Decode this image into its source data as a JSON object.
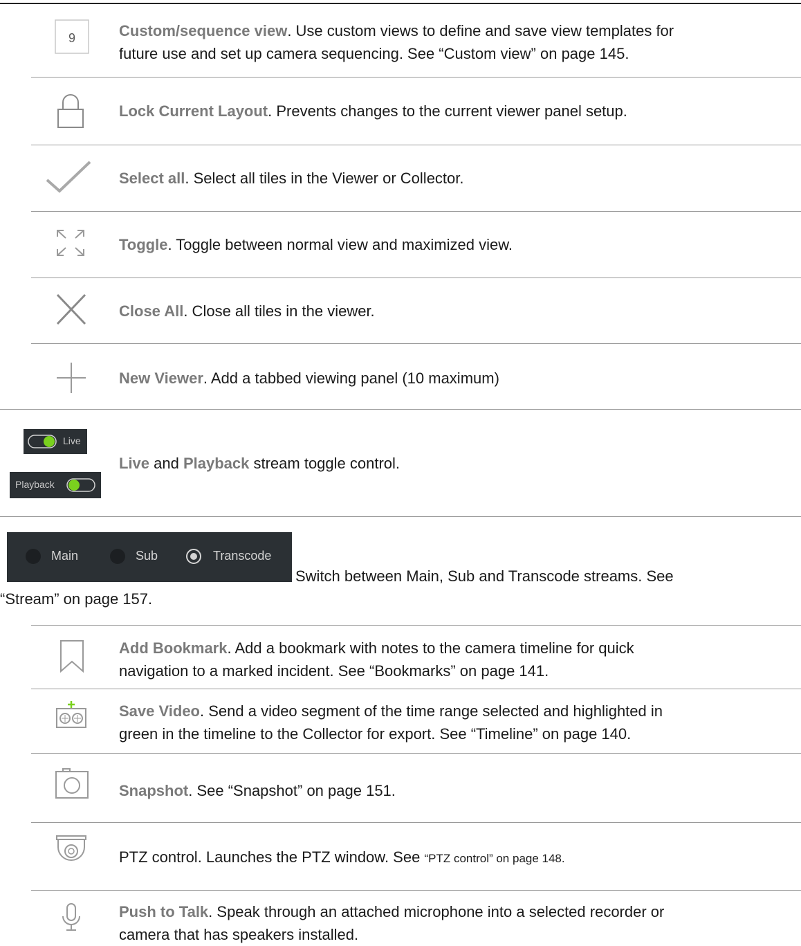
{
  "rows": {
    "custom": {
      "icon_number": "9",
      "term": "Custom/sequence view",
      "line1": ". Use custom views to define and save view templates for",
      "line2": "future use and set up camera sequencing. See “Custom view” on page 145."
    },
    "lock": {
      "term": "Lock Current Layout",
      "desc": ". Prevents changes to the current viewer panel setup."
    },
    "select_all": {
      "term": "Select all",
      "desc": ". Select all tiles in the Viewer or Collector."
    },
    "toggle": {
      "term": "Toggle",
      "desc": ". Toggle between normal view and maximized view."
    },
    "close_all": {
      "term": "Close All",
      "desc": ". Close all tiles in the viewer."
    },
    "new_viewer": {
      "term": "New Viewer",
      "desc": ". Add a tabbed viewing panel (10 maximum)"
    },
    "live_playback": {
      "live_label": "Live",
      "playback_label": "Playback",
      "term1": "Live",
      "and": " and ",
      "term2": "Playback",
      "desc": " stream toggle control."
    },
    "streams": {
      "options": [
        "Main",
        "Sub",
        "Transcode"
      ],
      "desc_line1": "Switch between Main, Sub and Transcode streams. See",
      "desc_line2": "“Stream” on page 157."
    },
    "bookmark": {
      "term": "Add Bookmark",
      "line1": ". Add a bookmark with notes to the camera timeline for quick",
      "line2": "navigation to a marked incident. See “Bookmarks” on page 141."
    },
    "save_video": {
      "term": "Save Video",
      "line1": ". Send a video segment of the time range selected and highlighted in",
      "line2": "green in the timeline to the Collector for export. See “Timeline” on page 140."
    },
    "snapshot": {
      "term": "Snapshot",
      "desc": ". See “Snapshot” on page 151."
    },
    "ptz": {
      "desc": "PTZ control. Launches the PTZ window. See ",
      "ref": "“PTZ control” on page 148."
    },
    "push_to_talk": {
      "term": "Push to Talk",
      "line1": ". Speak through an attached microphone into a selected recorder or",
      "line2": "camera that has speakers installed."
    }
  }
}
